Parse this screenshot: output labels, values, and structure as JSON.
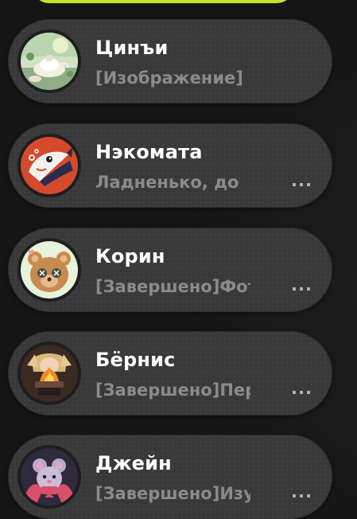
{
  "chats": [
    {
      "name": "Цинъи",
      "preview": "[Изображение]",
      "more": "",
      "avatar_icon": "character-qingyi-avatar-icon"
    },
    {
      "name": "Нэкомата",
      "preview": "Ладненько, до",
      "more": "...",
      "avatar_icon": "character-nekomata-avatar-icon"
    },
    {
      "name": "Корин",
      "preview": "[Завершено]Фото",
      "more": "...",
      "avatar_icon": "character-corin-avatar-icon"
    },
    {
      "name": "Бёрнис",
      "preview": "[Завершено]Пере",
      "more": "...",
      "avatar_icon": "character-burnice-avatar-icon"
    },
    {
      "name": "Джейн",
      "preview": "[Завершено]Изуч",
      "more": "...",
      "avatar_icon": "character-jane-avatar-icon"
    }
  ],
  "colors": {
    "accent": "#c3e22a",
    "card_bg": "#393939",
    "name_text": "#ffffff",
    "preview_text": "#8b8b8b"
  }
}
